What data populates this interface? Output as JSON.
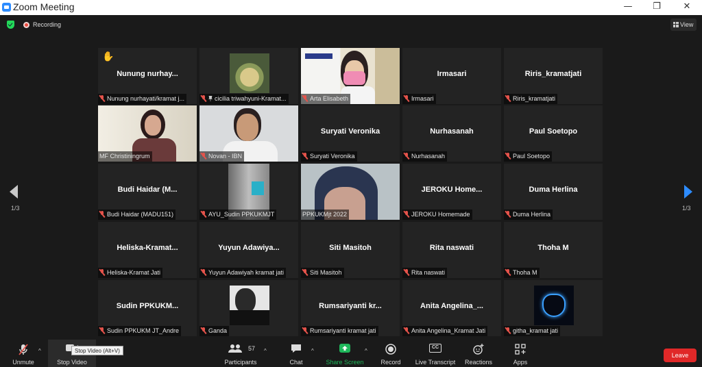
{
  "window": {
    "title": "Zoom Meeting",
    "controls": [
      "—",
      "❐",
      "✕"
    ]
  },
  "topbar": {
    "recording_label": "Recording",
    "view_label": "View"
  },
  "gallery": {
    "page_left": "1/3",
    "page_right": "1/3",
    "tiles": [
      {
        "center_name": "Nunung  nurhay...",
        "label": "Nunung nurhayati/kramat j...",
        "muted": true,
        "raised_hand": true
      },
      {
        "center_name": "",
        "label": "cicilia triwahyuni-Kramat...",
        "muted": true,
        "pinned": true,
        "video": "food-photo"
      },
      {
        "center_name": "",
        "label": "Arta Elisabeth",
        "muted": true,
        "video": "woman-mask-photo"
      },
      {
        "center_name": "Irmasari",
        "label": "Irmasari",
        "muted": true
      },
      {
        "center_name": "Riris_kramatjati",
        "label": "Riris_kramatjati",
        "muted": true
      },
      {
        "center_name": "",
        "label": "MF Christiningrum",
        "muted": false,
        "video": "woman-glasses-photo"
      },
      {
        "center_name": "",
        "label": "Novan - IBN",
        "muted": true,
        "video": "man-photo"
      },
      {
        "center_name": "Suryati Veronika",
        "label": "Suryati Veronika",
        "muted": true
      },
      {
        "center_name": "Nurhasanah",
        "label": "Nurhasanah",
        "muted": true
      },
      {
        "center_name": "Paul Soetopo",
        "label": "Paul Soetopo",
        "muted": true
      },
      {
        "center_name": "Budi  Haidar  (M...",
        "label": "Budi Haidar (MADU151)",
        "muted": true
      },
      {
        "center_name": "",
        "label": "AYU_Sudin PPKUKMJT",
        "muted": true,
        "video": "room-photo"
      },
      {
        "center_name": "",
        "label": "PPKUKMjt 2022",
        "muted": false,
        "speaking": true,
        "video": "hijab-woman-photo"
      },
      {
        "center_name": "JEROKU  Home...",
        "label": "JEROKU Homemade",
        "muted": true
      },
      {
        "center_name": "Duma Herlina",
        "label": "Duma Herlina",
        "muted": true
      },
      {
        "center_name": "Heliska-Kramat...",
        "label": "Heliska-Kramat Jati",
        "muted": true
      },
      {
        "center_name": "Yuyun  Adawiya...",
        "label": "Yuyun Adawiyah kramat jati",
        "muted": true
      },
      {
        "center_name": "Siti Masitoh",
        "label": "Siti Masitoh",
        "muted": true
      },
      {
        "center_name": "Rita naswati",
        "label": "Rita naswati",
        "muted": true
      },
      {
        "center_name": "Thoha M",
        "label": "Thoha M",
        "muted": true
      },
      {
        "center_name": "Sudin  PPKUKM...",
        "label": "Sudin PPKUKM JT_Andre",
        "muted": true
      },
      {
        "center_name": "",
        "label": "Ganda",
        "muted": true,
        "video": "bw-man-photo"
      },
      {
        "center_name": "Rumsariyanti  kr...",
        "label": "Rumsariyanti kramat jati",
        "muted": true
      },
      {
        "center_name": "Anita  Angelina_...",
        "label": "Anita Angelina_Kramat Jati",
        "muted": true
      },
      {
        "center_name": "",
        "label": "githa_kramat jati",
        "muted": true,
        "video": "neon-mask-graphic"
      }
    ]
  },
  "toolbar": {
    "unmute": "Unmute",
    "stop_video": "Stop Video",
    "tooltip": "Stop Video (Alt+V)",
    "participants": "Participants",
    "participants_count": "57",
    "chat": "Chat",
    "share_screen": "Share Screen",
    "record": "Record",
    "live_transcript": "Live Transcript",
    "cc_badge": "CC",
    "reactions": "Reactions",
    "apps": "Apps",
    "leave": "Leave"
  },
  "colors": {
    "accent": "#2D8CFF",
    "share_green": "#1fb85b",
    "leave_red": "#E02828",
    "muted_red": "#e5534b",
    "speaker_outline": "#c9e265"
  }
}
